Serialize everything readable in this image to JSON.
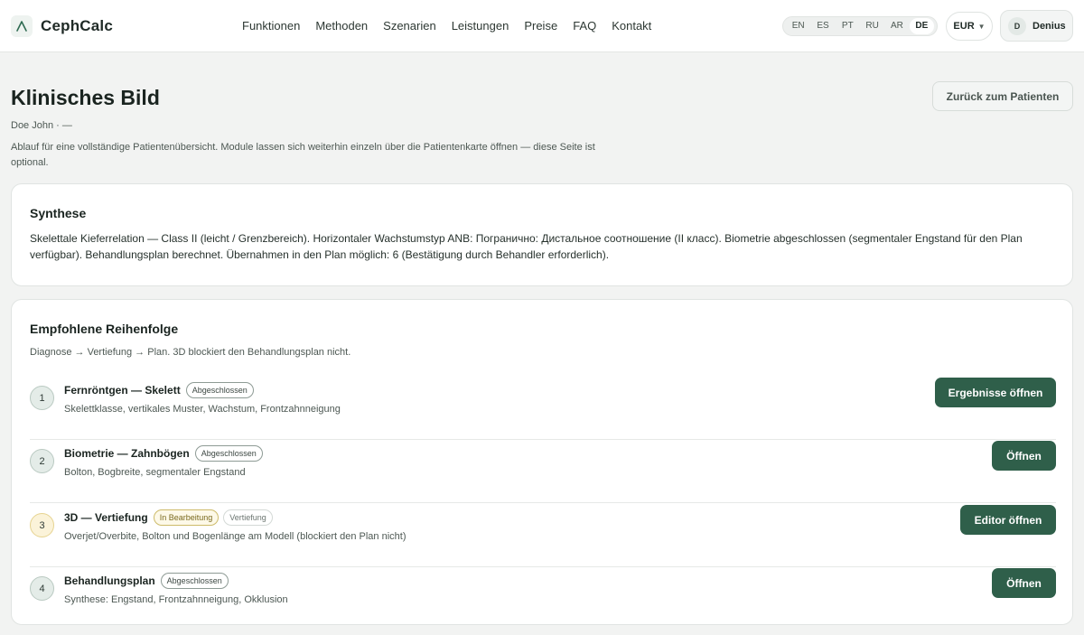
{
  "header": {
    "brand": "CephCalc",
    "nav": [
      "Funktionen",
      "Methoden",
      "Szenarien",
      "Leistungen",
      "Preise",
      "FAQ",
      "Kontakt"
    ],
    "languages": [
      "EN",
      "ES",
      "PT",
      "RU",
      "AR",
      "DE"
    ],
    "active_language": "DE",
    "currency": "EUR",
    "user_initial": "D",
    "user_name": "Denius"
  },
  "page": {
    "title": "Klinisches Bild",
    "patient": "Doe John · —",
    "intro": "Ablauf für eine vollständige Patientenübersicht. Module lassen sich weiterhin einzeln über die Patientenkarte öffnen — diese Seite ist optional.",
    "back_button": "Zurück zum Patienten"
  },
  "synthesis": {
    "title": "Synthese",
    "text": "Skelettale Kieferrelation — Class II (leicht / Grenzbereich). Horizontaler Wachstumstyp ANB: Погранично: Дистальное соотношение (II класс). Biometrie abgeschlossen (segmentaler Engstand für den Plan verfügbar). Behandlungsplan berechnet. Übernahmen in den Plan möglich: 6 (Bestätigung durch Behandler erforderlich)."
  },
  "order": {
    "title": "Empfohlene Reihenfolge",
    "subtitle": "Diagnose → Vertiefung → Plan. 3D blockiert den Behandlungsplan nicht.",
    "steps": [
      {
        "num": "1",
        "title": "Fernröntgen — Skelett",
        "badge": "Abgeschlossen",
        "badge2": "",
        "desc": "Skelettklasse, vertikales Muster, Wachstum, Frontzahnneigung",
        "button": "Ergebnisse öffnen"
      },
      {
        "num": "2",
        "title": "Biometrie — Zahnbögen",
        "badge": "Abgeschlossen",
        "badge2": "",
        "desc": "Bolton, Bogbreite, segmentaler Engstand",
        "button": "Öffnen"
      },
      {
        "num": "3",
        "title": "3D — Vertiefung",
        "badge": "In Bearbeitung",
        "badge2": "Vertiefung",
        "desc": "Overjet/Overbite, Bolton und Bogenlänge am Modell (blockiert den Plan nicht)",
        "button": "Editor öffnen"
      },
      {
        "num": "4",
        "title": "Behandlungsplan",
        "badge": "Abgeschlossen",
        "badge2": "",
        "desc": "Synthese: Engstand, Frontzahnneigung, Okklusion",
        "button": "Öffnen"
      }
    ]
  }
}
